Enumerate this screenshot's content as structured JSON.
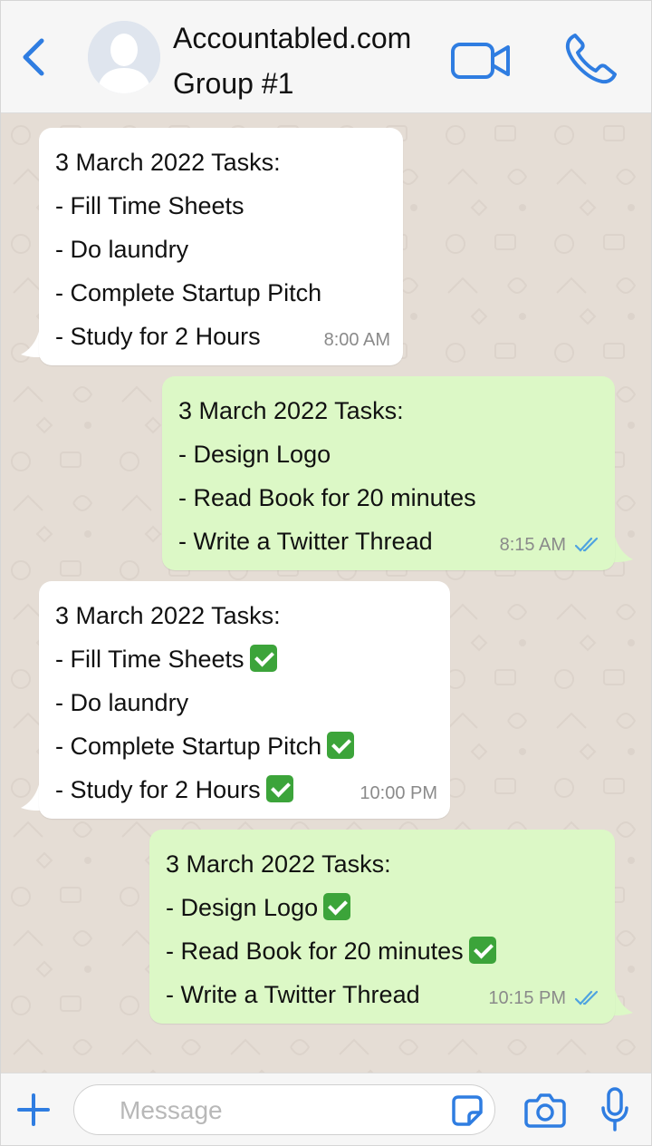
{
  "header": {
    "title_line1": "Accountabled.com",
    "title_line2": "Group #1",
    "icons": {
      "back": "chevron-left-icon",
      "video": "video-camera-icon",
      "call": "phone-icon",
      "avatar": "default-avatar-icon"
    },
    "accent_color": "#2f7de1"
  },
  "messages": [
    {
      "direction": "incoming",
      "lines": [
        "3 March 2022 Tasks:",
        "- Fill Time Sheets",
        "- Do laundry",
        "- Complete Startup Pitch",
        "- Study for 2 Hours"
      ],
      "time": "8:00 AM"
    },
    {
      "direction": "outgoing",
      "lines": [
        "3 March 2022 Tasks:",
        "- Design Logo",
        "- Read Book for 20 minutes",
        "- Write a Twitter Thread"
      ],
      "time": "8:15 AM",
      "status": "read-double-check-icon"
    },
    {
      "direction": "incoming",
      "lines": [
        "3 March 2022 Tasks:",
        "- Fill Time Sheets",
        "- Do laundry",
        "- Complete Startup Pitch",
        "- Study for 2 Hours"
      ],
      "checked": [
        false,
        true,
        false,
        true,
        true
      ],
      "time": "10:00 PM"
    },
    {
      "direction": "outgoing",
      "lines": [
        "3 March 2022 Tasks:",
        "- Design Logo",
        "- Read Book for 20 minutes",
        "- Write a Twitter Thread"
      ],
      "checked": [
        false,
        true,
        true,
        false
      ],
      "time": "10:15 PM",
      "status": "read-double-check-icon"
    }
  ],
  "input": {
    "placeholder": "Message",
    "value": "",
    "icons": {
      "add": "plus-icon",
      "sticker": "sticker-icon",
      "camera": "camera-icon",
      "mic": "microphone-icon"
    }
  },
  "colors": {
    "incoming_bubble": "#ffffff",
    "outgoing_bubble": "#dcf8c6",
    "chat_background": "#e5ddd5",
    "check_emoji": "#3ca43a"
  }
}
